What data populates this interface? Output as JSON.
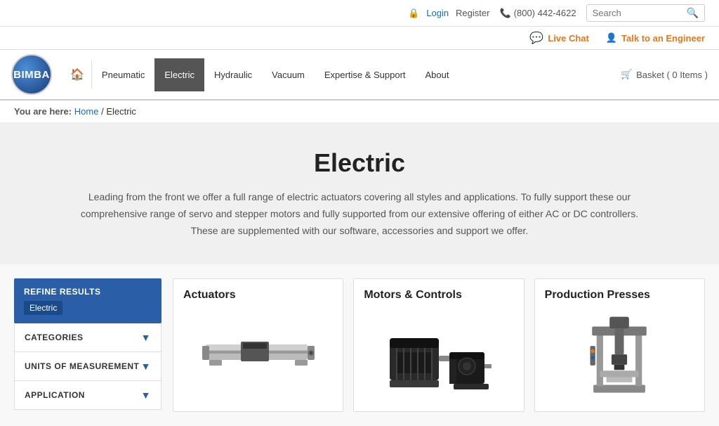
{
  "topbar": {
    "login": "Login",
    "register": "Register",
    "phone": "(800) 442-4622",
    "search_placeholder": "Search"
  },
  "actionbar": {
    "live_chat": "Live Chat",
    "engineer": "Talk to an Engineer"
  },
  "nav": {
    "home_icon": "🏠",
    "items": [
      {
        "label": "Pneumatic",
        "active": false
      },
      {
        "label": "Electric",
        "active": true
      },
      {
        "label": "Hydraulic",
        "active": false
      },
      {
        "label": "Vacuum",
        "active": false
      },
      {
        "label": "Expertise & Support",
        "active": false
      },
      {
        "label": "About",
        "active": false
      }
    ],
    "basket": "Basket ( 0 Items )"
  },
  "breadcrumb": {
    "prefix": "You are here:",
    "home": "Home",
    "separator": "/",
    "current": "Electric"
  },
  "hero": {
    "title": "Electric",
    "description": "Leading from the front we offer a full range of electric actuators covering all styles and applications. To fully support these our comprehensive range of servo and stepper motors and fully supported from our extensive offering of either AC or DC controllers. These are supplemented with our software, accessories and support we offer."
  },
  "sidebar": {
    "refine_title": "REFINE RESULTS",
    "refine_tag": "Electric",
    "filters": [
      {
        "label": "CATEGORIES"
      },
      {
        "label": "UNITS OF MEASUREMENT"
      },
      {
        "label": "APPLICATION"
      }
    ]
  },
  "products": [
    {
      "title": "Actuators",
      "type": "actuator"
    },
    {
      "title": "Motors & Controls",
      "type": "motors"
    },
    {
      "title": "Production Presses",
      "type": "press"
    }
  ],
  "logo_text": "BIMBA"
}
